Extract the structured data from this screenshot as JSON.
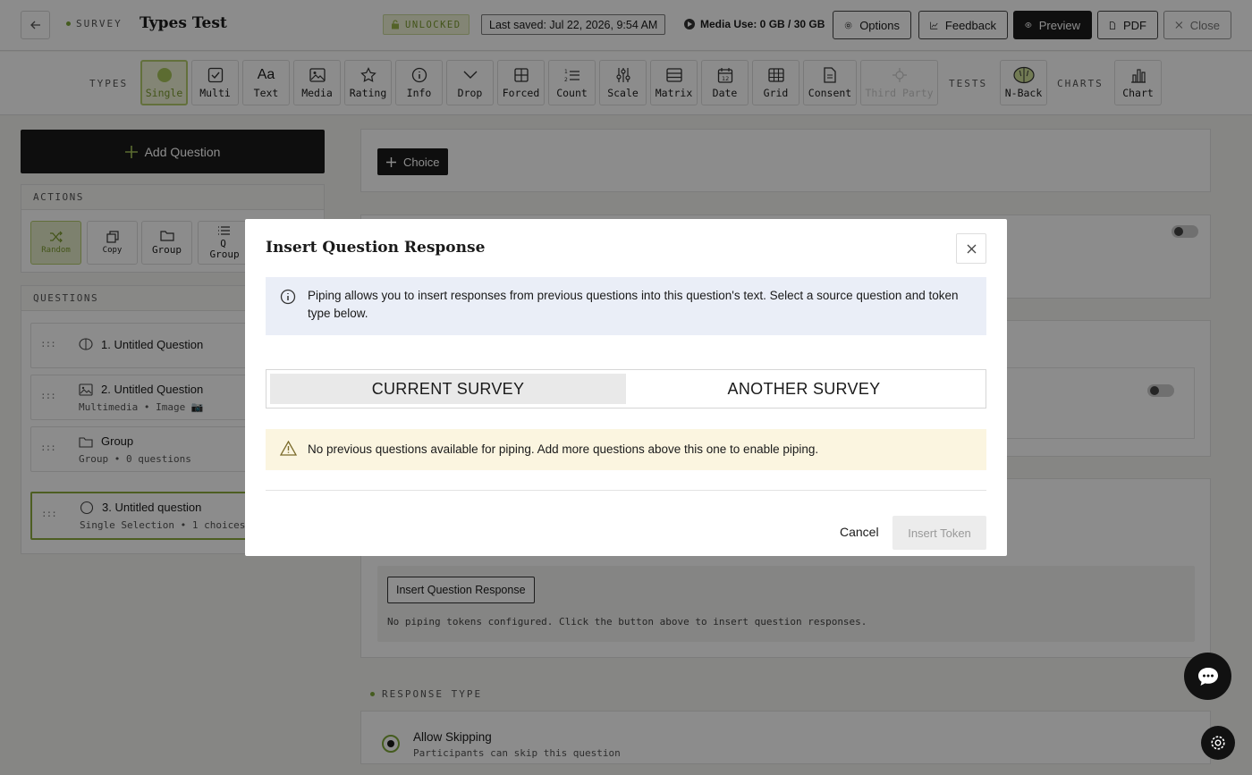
{
  "header": {
    "crumb": "SURVEY",
    "title": "Types Test",
    "lock_label": "UNLOCKED",
    "saved": "Last saved: Jul 22, 2026, 9:54 AM",
    "media_use": "Media Use: 0 GB / 30 GB",
    "buttons": {
      "options": "Options",
      "feedback": "Feedback",
      "preview": "Preview",
      "pdf": "PDF",
      "close": "Close"
    }
  },
  "types_bar": {
    "types_label": "TYPES",
    "types": [
      "Single",
      "Multi",
      "Text",
      "Media",
      "Rating",
      "Info",
      "Drop",
      "Forced",
      "Count",
      "Scale",
      "Matrix",
      "Date",
      "Grid",
      "Consent",
      "Third Party"
    ],
    "tests_label": "TESTS",
    "tests": [
      "N-Back"
    ],
    "charts_label": "CHARTS",
    "charts": [
      "Chart"
    ]
  },
  "sidebar": {
    "add_question": "Add Question",
    "actions_label": "ACTIONS",
    "actions": [
      "Random",
      "Copy",
      "Group",
      "Q Group"
    ],
    "questions_label": "QUESTIONS",
    "questions": [
      {
        "name": "1. Untitled Question",
        "sub": ""
      },
      {
        "name": "2. Untitled Question",
        "sub": "Multimedia • Image 📷"
      },
      {
        "name": "Group",
        "sub": "Group • 0 questions"
      },
      {
        "name": "3. Untitled question",
        "sub": "Single Selection • 1 choices"
      }
    ]
  },
  "main": {
    "choice_button": "Choice",
    "insert_response_button": "Insert Question Response",
    "piping_note": "No piping tokens configured. Click the button above to insert question responses.",
    "response_type_label": "RESPONSE TYPE",
    "allow_skipping": "Allow Skipping",
    "allow_skipping_sub": "Participants can skip this question"
  },
  "modal": {
    "title": "Insert Question Response",
    "info": "Piping allows you to insert responses from previous questions into this question's text. Select a source question and token type below.",
    "tabs": [
      "CURRENT SURVEY",
      "ANOTHER SURVEY"
    ],
    "warning": "No previous questions available for piping. Add more questions above this one to enable piping.",
    "cancel": "Cancel",
    "insert": "Insert Token"
  },
  "colors": {
    "accent_green": "#7ea83a",
    "dark": "#1a1a1a",
    "info_bg": "#eaeef7",
    "warn_bg": "#fbf5e0"
  }
}
